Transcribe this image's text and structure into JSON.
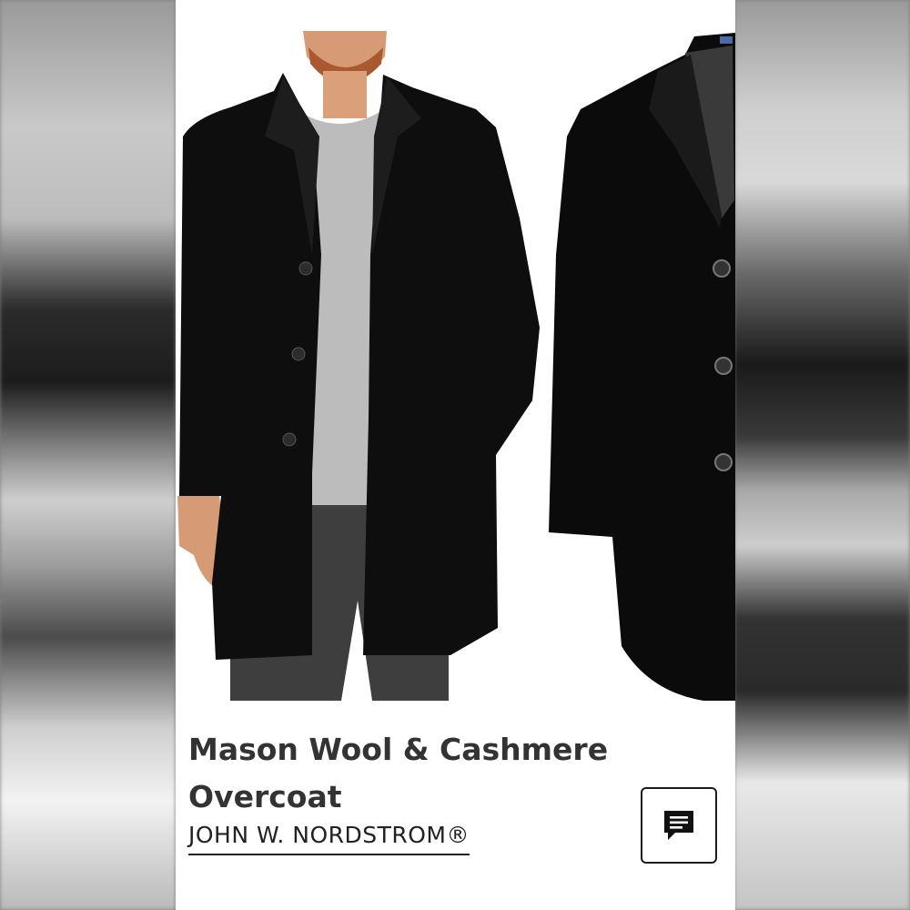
{
  "product": {
    "title": "Mason Wool & Cashmere Overcoat",
    "brand": "JOHN W. NORDSTROM®"
  },
  "images": [
    {
      "name": "model-wearing-coat-photo"
    },
    {
      "name": "coat-detail-photo"
    }
  ],
  "chat": {
    "icon": "chat-bubble-icon"
  },
  "colors": {
    "coat": "#0e0e0e",
    "sweater": "#bcbcbc",
    "trousers": "#3e3e3e",
    "text": "#333333"
  }
}
